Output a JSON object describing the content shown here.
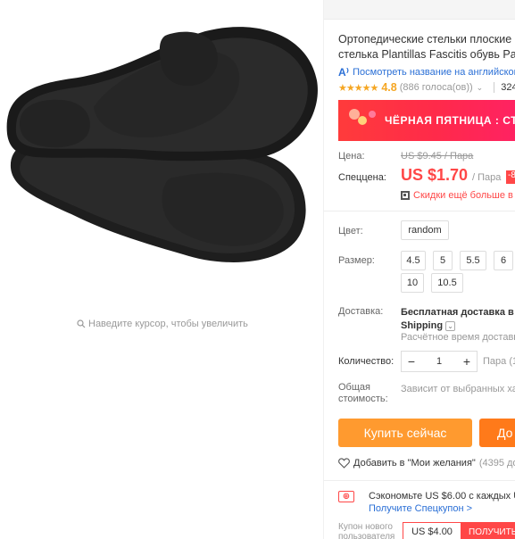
{
  "gallery": {
    "zoom_hint": "Наведите курсор, чтобы увеличить"
  },
  "product": {
    "title_line1": "Ортопедические стельки плоские",
    "title_line2": "стелька Plantillas Fascitis обувь Pa",
    "translate_link": "Посмотреть название на английском",
    "rating_value": "4.8",
    "votes": "(886 голоса(ов))",
    "orders": "324"
  },
  "banner": {
    "text": "ЧЁРНАЯ ПЯТНИЦА : СТ"
  },
  "price": {
    "label_price": "Цена:",
    "old": "US $9.45 / Пара",
    "label_special": "Спеццена:",
    "sale": "US $1.70",
    "unit": "/ Пара",
    "discount_badge": "-8",
    "more_discount": "Скидки ещё больше в п"
  },
  "options": {
    "color_label": "Цвет:",
    "color_value": "random",
    "size_label": "Размер:",
    "sizes": [
      "4.5",
      "5",
      "5.5",
      "6",
      "10",
      "10.5"
    ]
  },
  "shipping": {
    "label": "Доставка:",
    "value_line1": "Бесплатная доставка в Ru",
    "value_line2": "Shipping",
    "estimate": "Расчётное время доставки"
  },
  "quantity": {
    "label": "Количество:",
    "minus": "−",
    "value": "1",
    "plus": "+",
    "unit": "Пара (10"
  },
  "total": {
    "label_line1": "Общая",
    "label_line2": "стоимость:",
    "value": "Зависит от выбранных хар"
  },
  "actions": {
    "buy_now": "Купить сейчас",
    "add_to_cart": "До"
  },
  "wishlist": {
    "label": "Добавить в \"Мои желания\"",
    "count": "(4395 доб"
  },
  "promo": {
    "text": "Сэкономьте US $6.00 с каждых US $",
    "link": "Получите Спецкупон >"
  },
  "coupon": {
    "label_line1": "Купон нового",
    "label_line2": "пользователя",
    "value": "US $4.00",
    "get": "ПОЛУЧИТЬ"
  },
  "colors": {
    "accent_red": "#ff4747",
    "buy_orange": "#ff9a2f",
    "cart_orange": "#ff7a1a",
    "link_blue": "#2a6fd6",
    "star_gold": "#f5a623"
  }
}
